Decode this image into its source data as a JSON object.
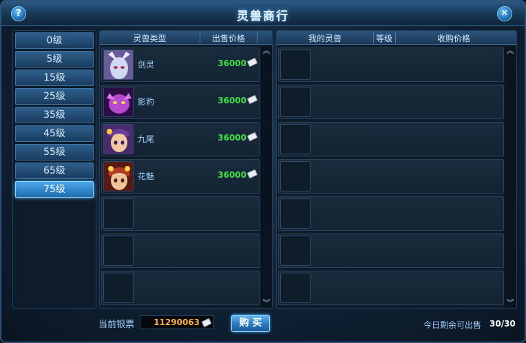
{
  "window": {
    "title": "灵兽商行",
    "help_glyph": "?",
    "close_glyph": "✕"
  },
  "levels": [
    {
      "label": "0级",
      "active": false
    },
    {
      "label": "5级",
      "active": false
    },
    {
      "label": "15级",
      "active": false
    },
    {
      "label": "25级",
      "active": false
    },
    {
      "label": "35级",
      "active": false
    },
    {
      "label": "45级",
      "active": false
    },
    {
      "label": "55级",
      "active": false
    },
    {
      "label": "65级",
      "active": false
    },
    {
      "label": "75级",
      "active": true
    }
  ],
  "shop": {
    "headers": {
      "type": "灵兽类型",
      "price": "出售价格"
    },
    "pets": [
      {
        "name": "剑灵",
        "price": "36000",
        "portrait_colors": [
          "#cfd7f2",
          "#7b5aa8"
        ],
        "icon": "silver-ticket-icon"
      },
      {
        "name": "影豹",
        "price": "36000",
        "portrait_colors": [
          "#b54ad0",
          "#3a1260"
        ],
        "icon": "silver-ticket-icon"
      },
      {
        "name": "九尾",
        "price": "36000",
        "portrait_colors": [
          "#f2c9a0",
          "#6a3f9a"
        ],
        "icon": "silver-ticket-icon"
      },
      {
        "name": "花魅",
        "price": "36000",
        "portrait_colors": [
          "#f0b07a",
          "#b23a24"
        ],
        "icon": "silver-ticket-icon"
      }
    ],
    "empty_rows": 3
  },
  "mine": {
    "headers": {
      "my_pet": "我的灵兽",
      "level": "等级",
      "buy_price": "收购价格"
    },
    "empty_rows": 7
  },
  "footer": {
    "current_label": "当前银票",
    "money": "11290063",
    "buy_label": "购 买",
    "remain_label": "今日剩余可出售",
    "remain_count": "30/30"
  },
  "scroll_glyphs": {
    "up": "︽",
    "down": "︾"
  }
}
